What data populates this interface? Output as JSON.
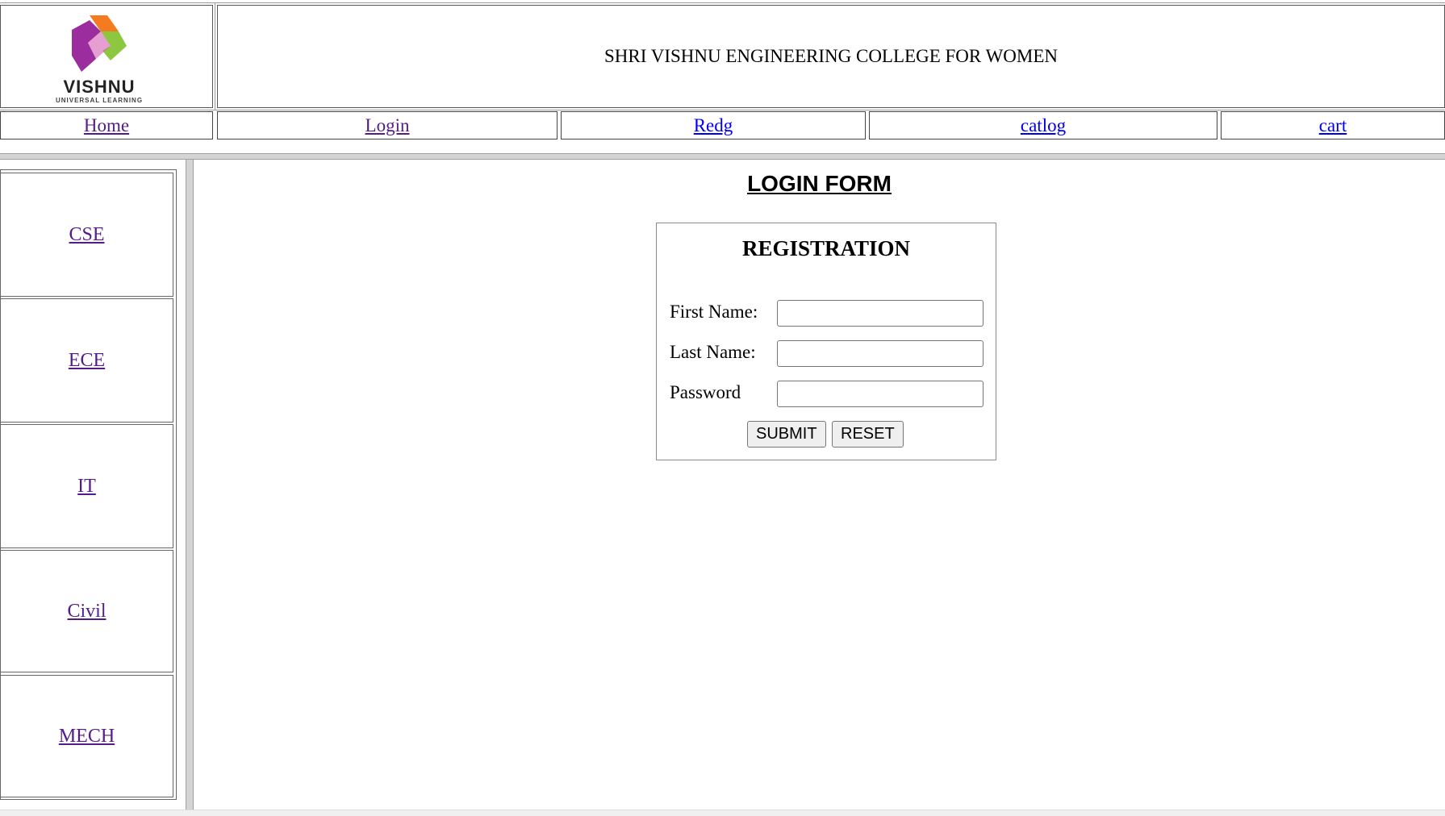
{
  "header": {
    "logo_text": "VISHNU",
    "logo_tagline": "UNIVERSAL LEARNING",
    "college_title": "SHRI VISHNU ENGINEERING COLLEGE FOR WOMEN"
  },
  "nav": [
    {
      "label": "Home",
      "visited": true
    },
    {
      "label": "Login",
      "visited": true
    },
    {
      "label": "Redg",
      "visited": false
    },
    {
      "label": "catlog",
      "visited": false
    },
    {
      "label": "cart",
      "visited": false
    }
  ],
  "sidebar": {
    "items": [
      {
        "label": "CSE"
      },
      {
        "label": "ECE"
      },
      {
        "label": "IT"
      },
      {
        "label": "Civil"
      },
      {
        "label": "MECH"
      }
    ]
  },
  "main": {
    "page_heading": "LOGIN FORM",
    "form": {
      "legend": "REGISTRATION",
      "first_name_label": "First Name:",
      "first_name_value": "",
      "last_name_label": "Last Name:",
      "last_name_value": "",
      "password_label": "Password",
      "password_value": "",
      "submit_label": "SUBMIT",
      "reset_label": "RESET"
    }
  },
  "colors": {
    "link_visited": "#551a8b",
    "link_unvisited": "#0000ee",
    "logo_orange": "#f47b20",
    "logo_purple": "#9b2d9e",
    "logo_green": "#8dc63f"
  }
}
